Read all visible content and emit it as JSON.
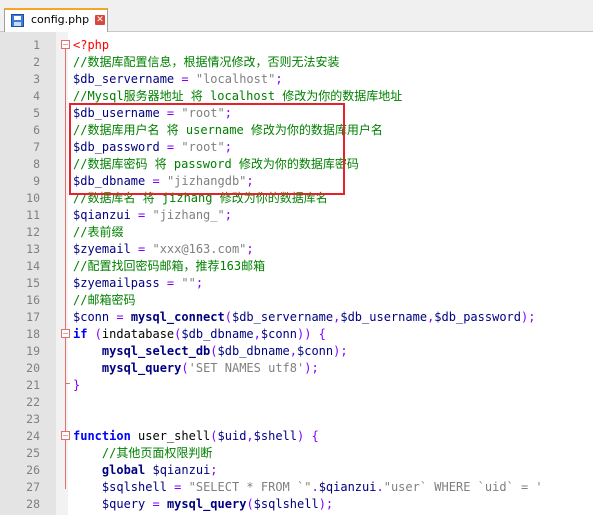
{
  "tab": {
    "title": "config.php",
    "icon": "save-disk-icon",
    "close": "✕"
  },
  "colors": {
    "highlight": "#e8202a",
    "keyword": "#0000ff",
    "comment": "#008000",
    "string": "#808080",
    "variable": "#000080",
    "operator": "#8000ff",
    "php_tag": "#ff0000"
  },
  "lines": [
    {
      "num": "1",
      "tokens": [
        {
          "t": "<?php",
          "c": "php"
        }
      ]
    },
    {
      "num": "2",
      "tokens": [
        {
          "t": "//数据库配置信息，根据情况修改，否则无法安装",
          "c": "cm"
        }
      ]
    },
    {
      "num": "3",
      "tokens": [
        {
          "t": "$db_servername",
          "c": "var"
        },
        {
          "t": " = ",
          "c": "op"
        },
        {
          "t": "\"localhost\"",
          "c": "str"
        },
        {
          "t": ";",
          "c": "op"
        }
      ]
    },
    {
      "num": "4",
      "tokens": [
        {
          "t": "//Mysql服务器地址 将 localhost 修改为你的数据库地址",
          "c": "cm"
        }
      ]
    },
    {
      "num": "5",
      "tokens": [
        {
          "t": "$db_username",
          "c": "var"
        },
        {
          "t": " = ",
          "c": "op"
        },
        {
          "t": "\"root\"",
          "c": "str"
        },
        {
          "t": ";",
          "c": "op"
        }
      ]
    },
    {
      "num": "6",
      "tokens": [
        {
          "t": "//数据库用户名 将 username 修改为你的数据库用户名",
          "c": "cm"
        }
      ]
    },
    {
      "num": "7",
      "tokens": [
        {
          "t": "$db_password",
          "c": "var"
        },
        {
          "t": " = ",
          "c": "op"
        },
        {
          "t": "\"root\"",
          "c": "str"
        },
        {
          "t": ";",
          "c": "op"
        }
      ]
    },
    {
      "num": "8",
      "tokens": [
        {
          "t": "//数据库密码 将 password 修改为你的数据库密码",
          "c": "cm"
        }
      ]
    },
    {
      "num": "9",
      "tokens": [
        {
          "t": "$db_dbname",
          "c": "var"
        },
        {
          "t": " = ",
          "c": "op"
        },
        {
          "t": "\"jizhangdb\"",
          "c": "str"
        },
        {
          "t": ";",
          "c": "op"
        }
      ]
    },
    {
      "num": "10",
      "tokens": [
        {
          "t": "//数据库名 将 jizhang 修改为你的数据库名",
          "c": "cm"
        }
      ]
    },
    {
      "num": "11",
      "tokens": [
        {
          "t": "$qianzui",
          "c": "var"
        },
        {
          "t": " = ",
          "c": "op"
        },
        {
          "t": "\"jizhang_\"",
          "c": "str"
        },
        {
          "t": ";",
          "c": "op"
        }
      ]
    },
    {
      "num": "12",
      "tokens": [
        {
          "t": "//表前缀",
          "c": "cm"
        }
      ]
    },
    {
      "num": "13",
      "tokens": [
        {
          "t": "$zyemail",
          "c": "var"
        },
        {
          "t": " = ",
          "c": "op"
        },
        {
          "t": "\"xxx@163.com\"",
          "c": "str"
        },
        {
          "t": ";",
          "c": "op"
        }
      ]
    },
    {
      "num": "14",
      "tokens": [
        {
          "t": "//配置找回密码邮箱，推荐163邮箱",
          "c": "cm"
        }
      ]
    },
    {
      "num": "15",
      "tokens": [
        {
          "t": "$zyemailpass",
          "c": "var"
        },
        {
          "t": " = ",
          "c": "op"
        },
        {
          "t": "\"\"",
          "c": "str"
        },
        {
          "t": ";",
          "c": "op"
        }
      ]
    },
    {
      "num": "16",
      "tokens": [
        {
          "t": "//邮箱密码",
          "c": "cm"
        }
      ]
    },
    {
      "num": "17",
      "tokens": [
        {
          "t": "$conn",
          "c": "var"
        },
        {
          "t": " = ",
          "c": "op"
        },
        {
          "t": "mysql_connect",
          "c": "fn"
        },
        {
          "t": "(",
          "c": "op"
        },
        {
          "t": "$db_servername",
          "c": "var"
        },
        {
          "t": ",",
          "c": "op"
        },
        {
          "t": "$db_username",
          "c": "var"
        },
        {
          "t": ",",
          "c": "op"
        },
        {
          "t": "$db_password",
          "c": "var"
        },
        {
          "t": ");",
          "c": "op"
        }
      ]
    },
    {
      "num": "18",
      "tokens": [
        {
          "t": "if",
          "c": "kw"
        },
        {
          "t": " (",
          "c": "op"
        },
        {
          "t": "indatabase",
          "c": "plain"
        },
        {
          "t": "(",
          "c": "op"
        },
        {
          "t": "$db_dbname",
          "c": "var"
        },
        {
          "t": ",",
          "c": "op"
        },
        {
          "t": "$conn",
          "c": "var"
        },
        {
          "t": ")) {",
          "c": "op"
        }
      ]
    },
    {
      "num": "19",
      "tokens": [
        {
          "t": "    ",
          "c": "plain"
        },
        {
          "t": "mysql_select_db",
          "c": "fn"
        },
        {
          "t": "(",
          "c": "op"
        },
        {
          "t": "$db_dbname",
          "c": "var"
        },
        {
          "t": ",",
          "c": "op"
        },
        {
          "t": "$conn",
          "c": "var"
        },
        {
          "t": ");",
          "c": "op"
        }
      ]
    },
    {
      "num": "20",
      "tokens": [
        {
          "t": "    ",
          "c": "plain"
        },
        {
          "t": "mysql_query",
          "c": "fn"
        },
        {
          "t": "(",
          "c": "op"
        },
        {
          "t": "'SET NAMES utf8'",
          "c": "str"
        },
        {
          "t": ");",
          "c": "op"
        }
      ]
    },
    {
      "num": "21",
      "tokens": [
        {
          "t": "}",
          "c": "op"
        }
      ]
    },
    {
      "num": "22",
      "tokens": []
    },
    {
      "num": "23",
      "tokens": []
    },
    {
      "num": "24",
      "tokens": [
        {
          "t": "function",
          "c": "kw"
        },
        {
          "t": " ",
          "c": "plain"
        },
        {
          "t": "user_shell",
          "c": "plain"
        },
        {
          "t": "(",
          "c": "op"
        },
        {
          "t": "$uid",
          "c": "var"
        },
        {
          "t": ",",
          "c": "op"
        },
        {
          "t": "$shell",
          "c": "var"
        },
        {
          "t": ") {",
          "c": "op"
        }
      ]
    },
    {
      "num": "25",
      "tokens": [
        {
          "t": "    ",
          "c": "plain"
        },
        {
          "t": "//其他页面权限判断",
          "c": "cm"
        }
      ]
    },
    {
      "num": "26",
      "tokens": [
        {
          "t": "    ",
          "c": "plain"
        },
        {
          "t": "global",
          "c": "fn"
        },
        {
          "t": " ",
          "c": "plain"
        },
        {
          "t": "$qianzui",
          "c": "var"
        },
        {
          "t": ";",
          "c": "op"
        }
      ]
    },
    {
      "num": "27",
      "tokens": [
        {
          "t": "    ",
          "c": "plain"
        },
        {
          "t": "$sqlshell",
          "c": "var"
        },
        {
          "t": " = ",
          "c": "op"
        },
        {
          "t": "\"SELECT * FROM `\"",
          "c": "str"
        },
        {
          "t": ".",
          "c": "op"
        },
        {
          "t": "$qianzui",
          "c": "var"
        },
        {
          "t": ".",
          "c": "op"
        },
        {
          "t": "\"user` WHERE `uid` = '",
          "c": "str"
        }
      ]
    },
    {
      "num": "28",
      "tokens": [
        {
          "t": "    ",
          "c": "plain"
        },
        {
          "t": "$query",
          "c": "var"
        },
        {
          "t": " = ",
          "c": "op"
        },
        {
          "t": "mysql_query",
          "c": "fn"
        },
        {
          "t": "(",
          "c": "op"
        },
        {
          "t": "$sqlshell",
          "c": "var"
        },
        {
          "t": ");",
          "c": "op"
        }
      ]
    }
  ]
}
